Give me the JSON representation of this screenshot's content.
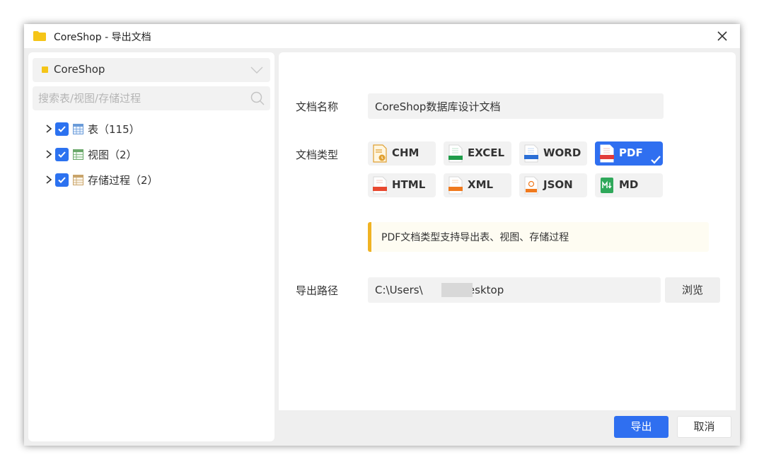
{
  "window": {
    "title": "CoreShop - 导出文档",
    "accent_color": "#2f6ff0",
    "folder_color": "#f5c518"
  },
  "left": {
    "database": "CoreShop",
    "search_placeholder": "搜索表/视图/存储过程",
    "tree": [
      {
        "label": "表（115）",
        "checked": true,
        "icon": "table-icon"
      },
      {
        "label": "视图（2）",
        "checked": true,
        "icon": "view-icon"
      },
      {
        "label": "存储过程（2）",
        "checked": true,
        "icon": "procedure-icon"
      }
    ]
  },
  "form": {
    "name_label": "文档名称",
    "name_value": "CoreShop数据库设计文档",
    "type_label": "文档类型",
    "types": [
      {
        "label": "CHM",
        "icon": "chm-file-icon",
        "selected": false
      },
      {
        "label": "EXCEL",
        "icon": "excel-file-icon",
        "selected": false
      },
      {
        "label": "WORD",
        "icon": "word-file-icon",
        "selected": false
      },
      {
        "label": "PDF",
        "icon": "pdf-file-icon",
        "selected": true
      },
      {
        "label": "HTML",
        "icon": "html-file-icon",
        "selected": false
      },
      {
        "label": "XML",
        "icon": "xml-file-icon",
        "selected": false
      },
      {
        "label": "JSON",
        "icon": "json-file-icon",
        "selected": false
      },
      {
        "label": "MD",
        "icon": "md-file-icon",
        "selected": false
      }
    ],
    "type_hint": "PDF文档类型支持导出表、视图、存储过程",
    "path_label": "导出路径",
    "path_value": "C:\\Users\\          \\Desktop",
    "browse_label": "浏览"
  },
  "footer": {
    "export_label": "导出",
    "cancel_label": "取消"
  }
}
